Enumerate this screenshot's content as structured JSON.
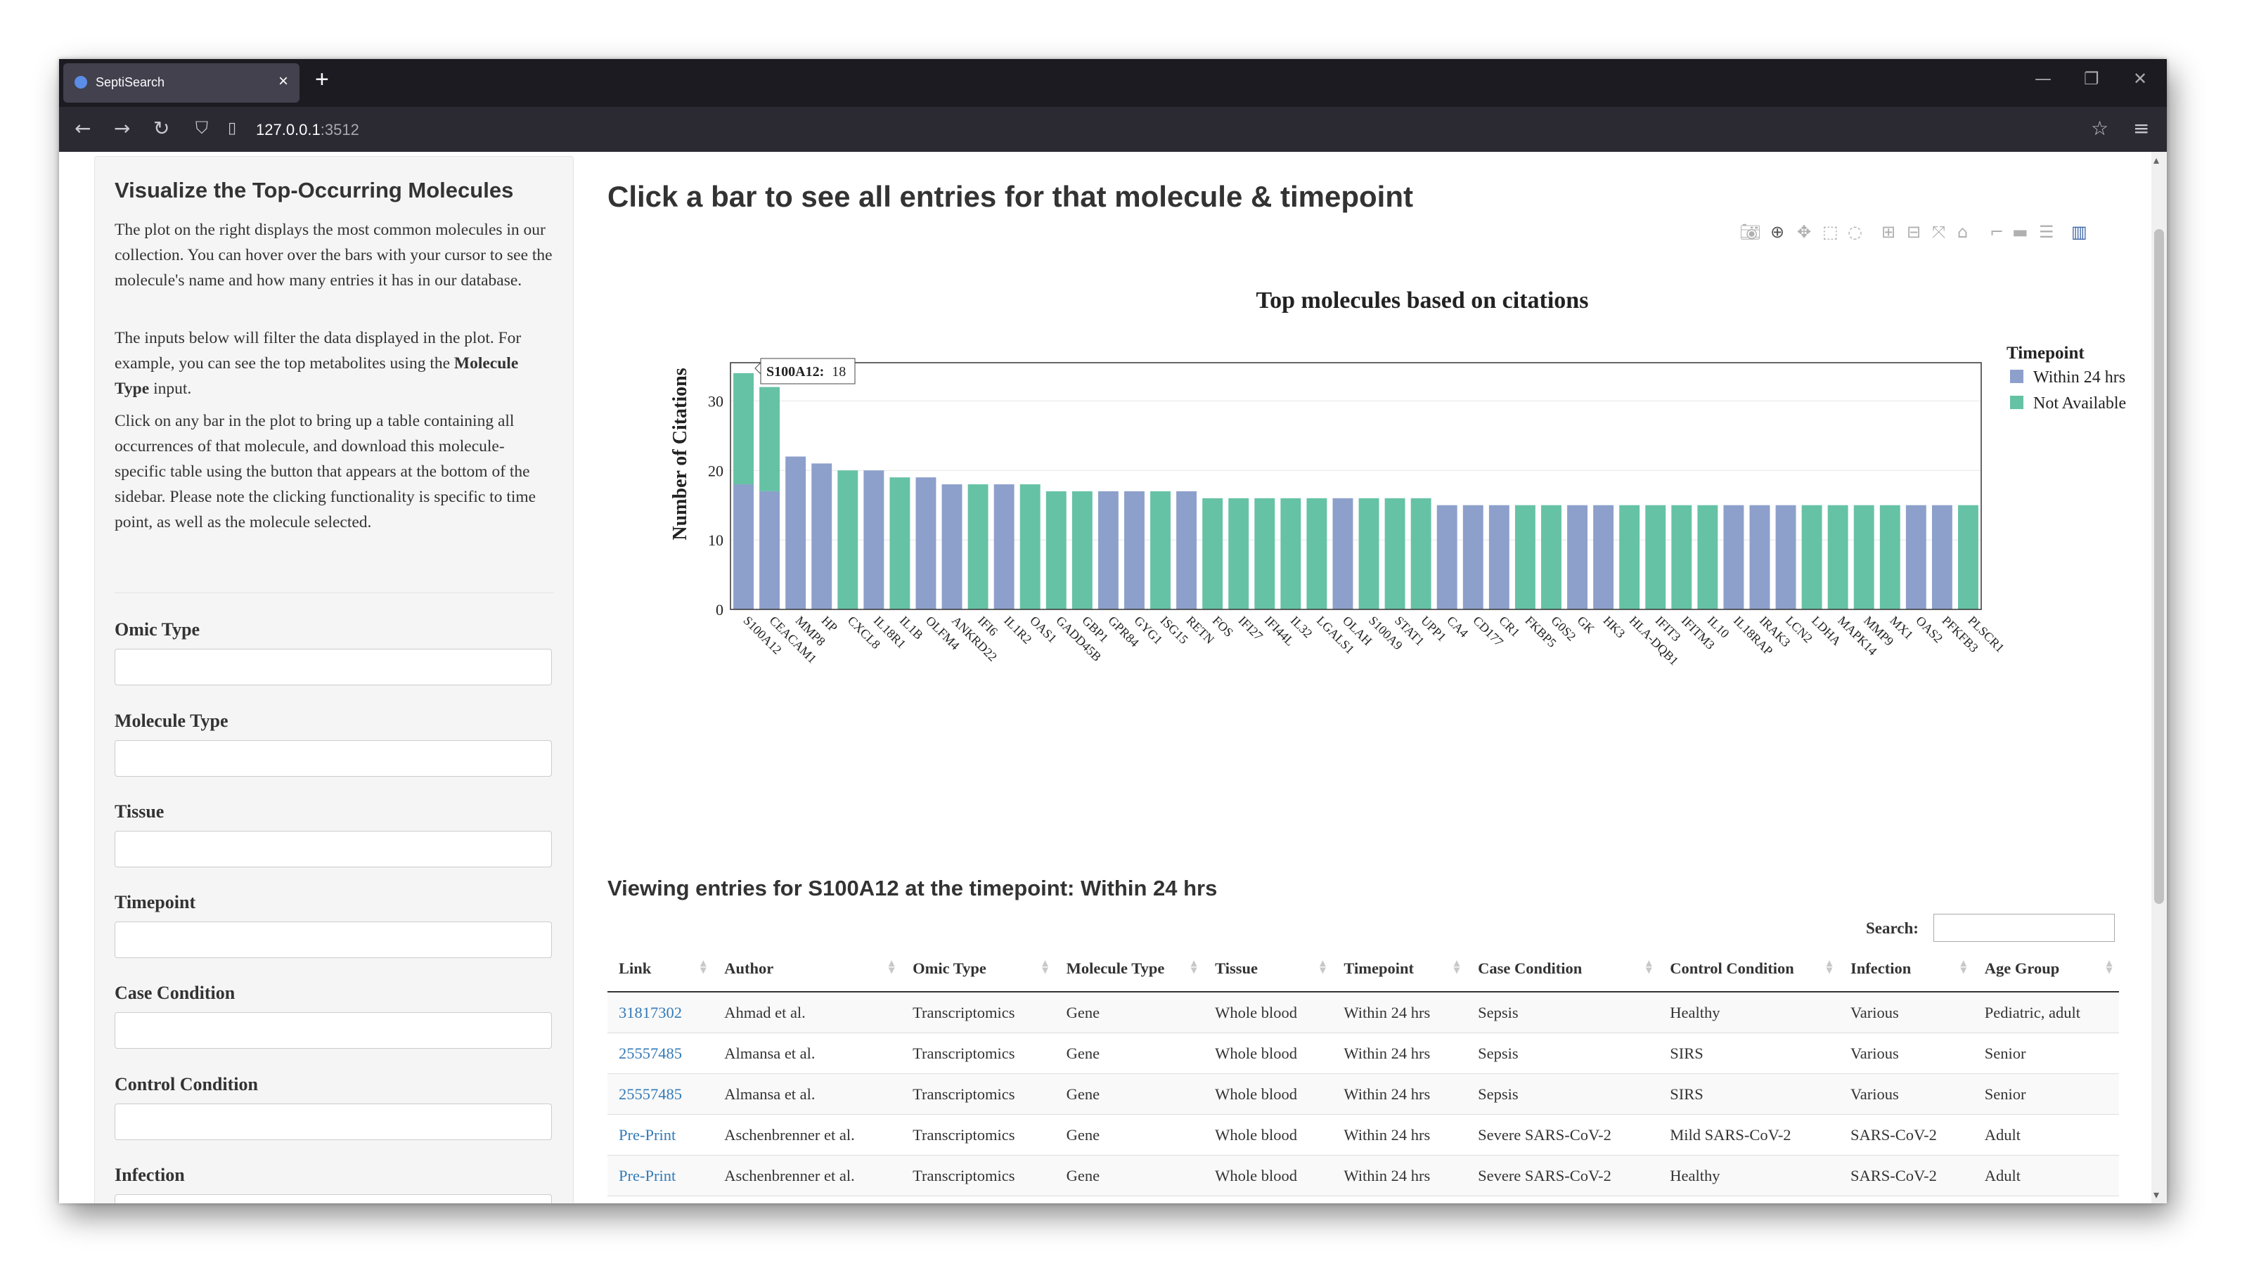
{
  "browser": {
    "tab_title": "SeptiSearch",
    "tab_close": "×",
    "new_tab": "+",
    "url_host": "127.0.0.1",
    "url_port": ":3512",
    "controls": {
      "minimize": "—",
      "restore": "❐",
      "close": "✕"
    }
  },
  "sidebar": {
    "title": "Visualize the Top-Occurring Molecules",
    "para1": "The plot on the right displays the most common molecules in our collection. You can hover over the bars with your cursor to see the molecule's name and how many entries it has in our database.",
    "para2_pre": "The inputs below will filter the data displayed in the plot. For example, you can see the top metabolites using the ",
    "para2_bold": "Molecule Type",
    "para2_post": " input.",
    "para3": "Click on any bar in the plot to bring up a table containing all occurrences of that molecule, and download this molecule- specific table using the button that appears at the bottom of the sidebar. Please note the clicking functionality is specific to time point, as well as the molecule selected.",
    "filters": [
      "Omic Type",
      "Molecule Type",
      "Tissue",
      "Timepoint",
      "Case Condition",
      "Control Condition",
      "Infection"
    ]
  },
  "main": {
    "title": "Click a bar to see all entries for that molecule & timepoint",
    "view_title": "Viewing entries for S100A12 at the timepoint: Within 24 hrs",
    "search_label": "Search:"
  },
  "tooltip": {
    "name": "S100A12:",
    "value": "18"
  },
  "colors": {
    "within": "#8da0cb",
    "na": "#66c2a5"
  },
  "chart_data": {
    "type": "bar",
    "title": "Top molecules based on citations",
    "ylabel": "Number of Citations",
    "xlabel": "",
    "ylim": [
      0,
      35.5
    ],
    "yticks": [
      0,
      10,
      20,
      30
    ],
    "legend_title": "Timepoint",
    "legend_position": "right",
    "categories": [
      "S100A12",
      "CEACAM1",
      "MMP8",
      "HP",
      "CXCL8",
      "IL18R1",
      "IL1B",
      "OLFM4",
      "ANKRD22",
      "IFI6",
      "IL1R2",
      "OAS1",
      "GADD45B",
      "GBP1",
      "GPR84",
      "GYG1",
      "ISG15",
      "RETN",
      "FOS",
      "IFI27",
      "IFI44L",
      "IL32",
      "LGALS1",
      "OLAH",
      "S100A9",
      "STAT1",
      "UPP1",
      "CA4",
      "CD177",
      "CR1",
      "FKBP5",
      "G0S2",
      "GK",
      "HK3",
      "HLA-DQB1",
      "IFIT3",
      "IFITM3",
      "IL10",
      "IL18RAP",
      "IRAK3",
      "LCN2",
      "LDHA",
      "MAPK14",
      "MMP9",
      "MX1",
      "OAS2",
      "PFKFB3",
      "PLSCR1"
    ],
    "series": [
      {
        "name": "Within 24 hrs",
        "values": [
          18,
          17,
          22,
          21,
          0,
          20,
          0,
          19,
          18,
          0,
          18,
          0,
          0,
          0,
          17,
          17,
          0,
          17,
          0,
          0,
          0,
          0,
          0,
          16,
          0,
          0,
          0,
          15,
          15,
          15,
          0,
          0,
          15,
          15,
          0,
          0,
          0,
          0,
          15,
          15,
          15,
          0,
          0,
          0,
          0,
          15,
          15,
          0
        ]
      },
      {
        "name": "Not Available",
        "values": [
          16,
          15,
          0,
          0,
          20,
          0,
          19,
          0,
          0,
          18,
          0,
          18,
          17,
          17,
          0,
          0,
          17,
          0,
          16,
          16,
          16,
          16,
          16,
          0,
          16,
          16,
          16,
          0,
          0,
          0,
          15,
          15,
          0,
          0,
          15,
          15,
          15,
          15,
          0,
          0,
          0,
          15,
          15,
          15,
          15,
          0,
          0,
          15
        ]
      }
    ]
  },
  "table": {
    "columns": [
      "Link",
      "Author",
      "Omic Type",
      "Molecule Type",
      "Tissue",
      "Timepoint",
      "Case Condition",
      "Control Condition",
      "Infection",
      "Age Group"
    ],
    "rows": [
      [
        "31817302",
        "Ahmad et al.",
        "Transcriptomics",
        "Gene",
        "Whole blood",
        "Within 24 hrs",
        "Sepsis",
        "Healthy",
        "Various",
        "Pediatric, adult"
      ],
      [
        "25557485",
        "Almansa et al.",
        "Transcriptomics",
        "Gene",
        "Whole blood",
        "Within 24 hrs",
        "Sepsis",
        "SIRS",
        "Various",
        "Senior"
      ],
      [
        "25557485",
        "Almansa et al.",
        "Transcriptomics",
        "Gene",
        "Whole blood",
        "Within 24 hrs",
        "Sepsis",
        "SIRS",
        "Various",
        "Senior"
      ],
      [
        "Pre-Print",
        "Aschenbrenner et al.",
        "Transcriptomics",
        "Gene",
        "Whole blood",
        "Within 24 hrs",
        "Severe SARS-CoV-2",
        "Mild SARS-CoV-2",
        "SARS-CoV-2",
        "Adult"
      ],
      [
        "Pre-Print",
        "Aschenbrenner et al.",
        "Transcriptomics",
        "Gene",
        "Whole blood",
        "Within 24 hrs",
        "Severe SARS-CoV-2",
        "Healthy",
        "SARS-CoV-2",
        "Adult"
      ]
    ]
  }
}
